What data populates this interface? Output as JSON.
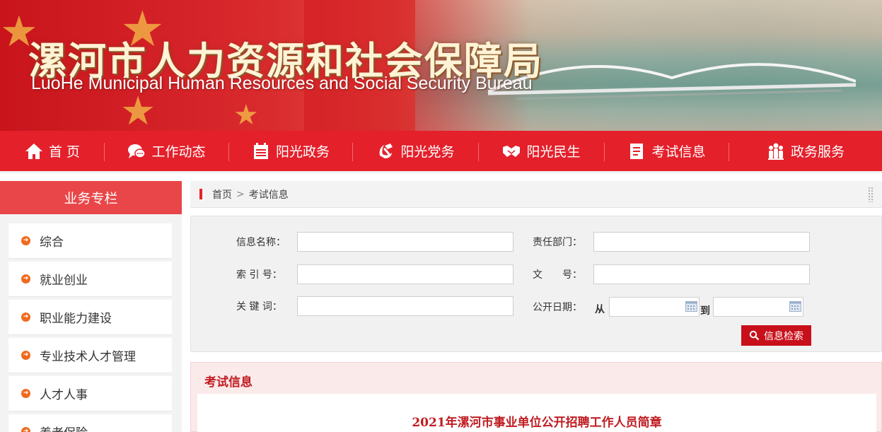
{
  "banner": {
    "title_cn": "漯河市人力资源和社会保障局",
    "title_en": "LuoHe Municipal Human Resources and Social Security Bureau"
  },
  "nav": {
    "items": [
      {
        "label": "首 页",
        "icon": "home-icon"
      },
      {
        "label": "工作动态",
        "icon": "chat-icon"
      },
      {
        "label": "阳光政务",
        "icon": "calendar-icon"
      },
      {
        "label": "阳光党务",
        "icon": "party-emblem-icon"
      },
      {
        "label": "阳光民生",
        "icon": "handshake-icon"
      },
      {
        "label": "考试信息",
        "icon": "document-icon"
      },
      {
        "label": "政务服务",
        "icon": "people-icon"
      }
    ]
  },
  "sidebar": {
    "title": "业务专栏",
    "items": [
      {
        "label": "综合"
      },
      {
        "label": "就业创业"
      },
      {
        "label": "职业能力建设"
      },
      {
        "label": "专业技术人才管理"
      },
      {
        "label": "人才人事"
      },
      {
        "label": "养老保险"
      }
    ]
  },
  "breadcrumb": {
    "home": "首页",
    "separator": ">",
    "current": "考试信息"
  },
  "search": {
    "info_name_label": "信息名称：",
    "dept_label": "责任部门：",
    "index_label": "索 引 号：",
    "doc_no_label": "文　　号：",
    "keyword_label": "关 键 词：",
    "date_label": "公开日期：",
    "from_label": "从",
    "to_label": "到",
    "button_label": "信息检索",
    "info_name_value": "",
    "dept_value": "",
    "index_value": "",
    "doc_no_value": "",
    "keyword_value": "",
    "date_from_value": "",
    "date_to_value": ""
  },
  "exam": {
    "section_title": "考试信息",
    "article_title": "2021年漯河市事业单位公开招聘工作人员简章"
  },
  "colors": {
    "brand_red": "#e4202b",
    "sidebar_head": "#e84649",
    "button_red": "#c8101b",
    "bullet_orange": "#ef6a1d"
  }
}
